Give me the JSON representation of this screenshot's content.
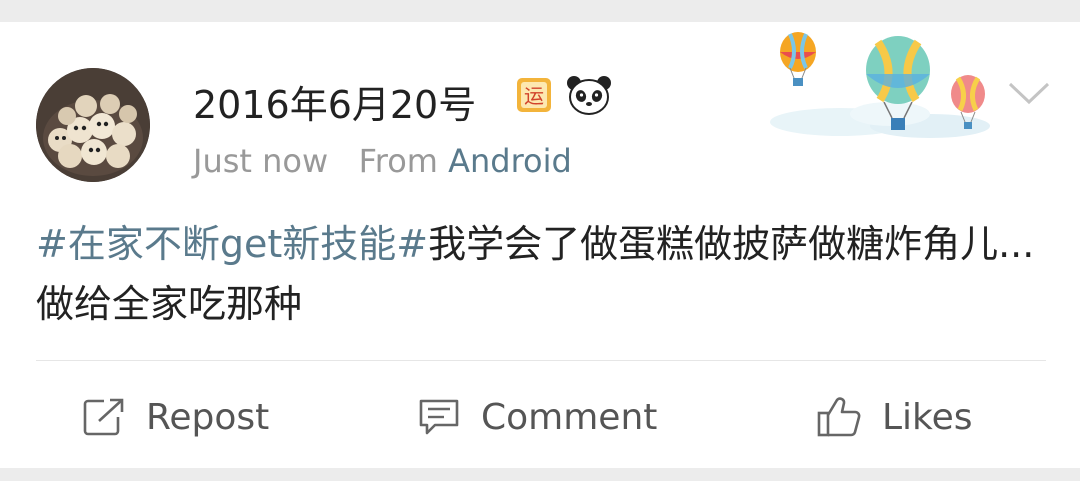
{
  "post": {
    "username": "2016年6月20号",
    "time": "Just now",
    "source_prefix": "From",
    "source_app": "Android",
    "hashtag": "#在家不断get新技能#",
    "text": "我学会了做蛋糕做披萨做糖炸角儿...做给全家吃那种"
  },
  "badges": {
    "badge_icon": "yun-badge-icon",
    "badge_char": "运",
    "emoji_icon": "panda-icon"
  },
  "actions": {
    "repost": "Repost",
    "comment": "Comment",
    "likes": "Likes"
  },
  "colors": {
    "link": "#5a7a8c",
    "text": "#222222",
    "meta": "#999999",
    "background": "#ececec"
  }
}
